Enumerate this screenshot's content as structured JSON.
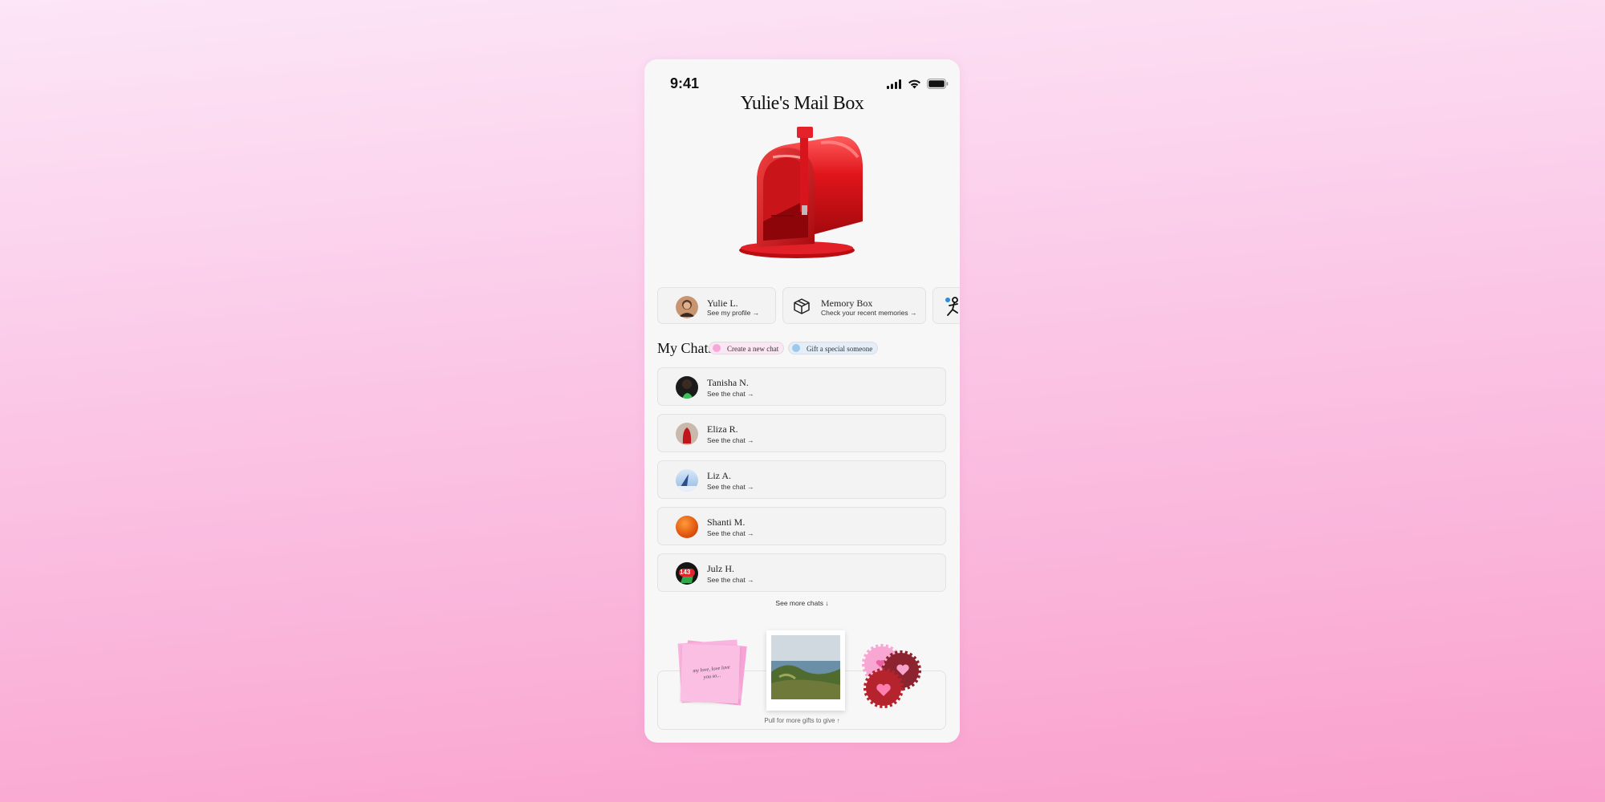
{
  "status_bar": {
    "time": "9:41"
  },
  "header": {
    "title": "Yulie's Mail Box"
  },
  "quick_cards": [
    {
      "title": "Yulie L.",
      "subtitle": "See my profile →"
    },
    {
      "title": "Memory Box",
      "subtitle": "Check your recent memories →"
    }
  ],
  "chats_section": {
    "title": "My Chats",
    "create_label": "Create a new chat",
    "gift_label": "Gift a special someone"
  },
  "chats": [
    {
      "name": "Tanisha N.",
      "subtitle": "See the chat →"
    },
    {
      "name": "Eliza R.",
      "subtitle": "See the chat →"
    },
    {
      "name": "Liz A.",
      "subtitle": "See the chat →"
    },
    {
      "name": "Shanti M.",
      "subtitle": "See the chat →"
    },
    {
      "name": "Julz H.",
      "subtitle": "See the chat →"
    }
  ],
  "see_more": "See more chats ↓",
  "gifts": {
    "note_text": "my love, love love you so...",
    "pull_label": "Pull for more gifts to give ↑",
    "badge": "143"
  },
  "colors": {
    "accent_pink": "#f7a8d8",
    "accent_blue": "#9dc8ee",
    "mailbox_red": "#d8151c"
  }
}
